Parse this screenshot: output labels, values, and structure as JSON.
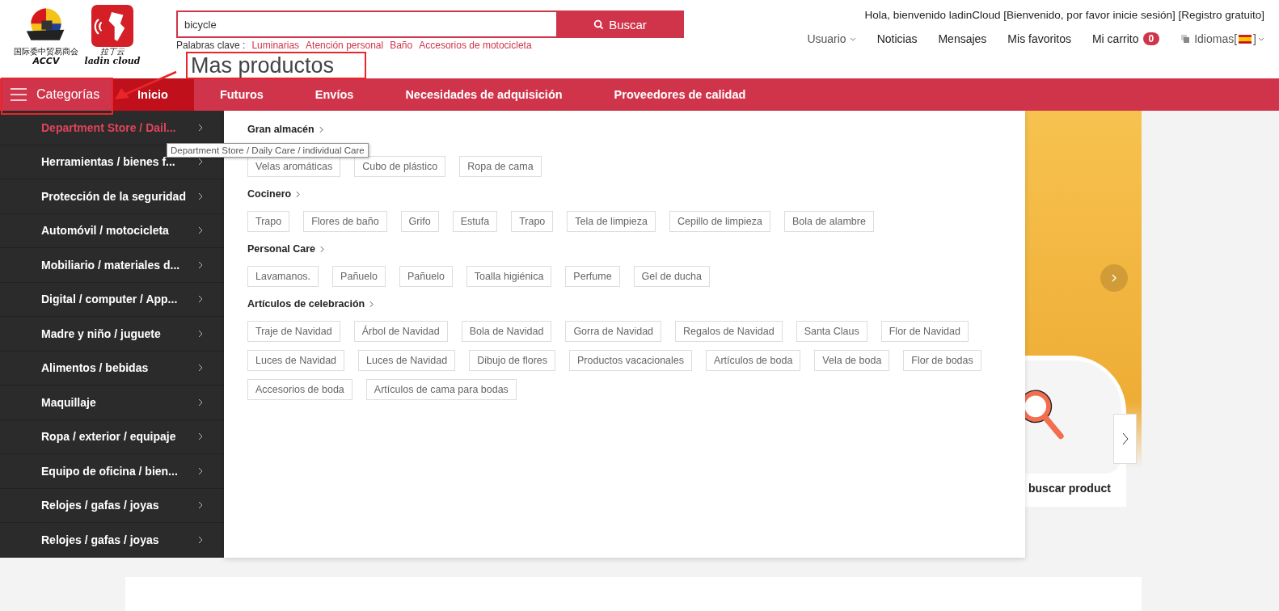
{
  "logos": [
    {
      "kind": "accv",
      "lines": [
        "国际委中贸易商会",
        "ACCV"
      ]
    },
    {
      "kind": "ladin",
      "lines": [
        "拉丁云",
        "ladin cloud"
      ]
    }
  ],
  "search": {
    "value": "bicycle",
    "button": "Buscar",
    "keywords_label": "Palabras clave :",
    "keywords": [
      "Luminarias",
      "Atención personal",
      "Baño",
      "Accesorios de motocicleta"
    ]
  },
  "welcome": "Hola, bienvenido ladinCloud [Bienvenido, por favor inicie sesión] [Registro gratuito]",
  "user_menu": [
    {
      "label": "Usuario",
      "kind": "dropdown"
    },
    {
      "label": "Noticias",
      "kind": "link"
    },
    {
      "label": "Mensajes",
      "kind": "link"
    },
    {
      "label": "Mis favoritos",
      "kind": "link"
    },
    {
      "label": "Mi carrito",
      "kind": "cart",
      "badge": "0"
    },
    {
      "label": "Idiomas[",
      "after": "]",
      "kind": "language"
    }
  ],
  "annotation": {
    "label": "Mas productos"
  },
  "categories_button": "Categorías",
  "nav": [
    {
      "label": "Inicio",
      "selected": true
    },
    {
      "label": "Futuros",
      "selected": false
    },
    {
      "label": "Envíos",
      "selected": false
    },
    {
      "label": "Necesidades de adquisición",
      "selected": false
    },
    {
      "label": "Proveedores de calidad",
      "selected": false
    }
  ],
  "sidebar": {
    "items": [
      {
        "label": "Department Store / Dail...",
        "selected": true
      },
      {
        "label": "Herramientas / bienes f...",
        "selected": false
      },
      {
        "label": "Protección de la seguridad",
        "selected": false
      },
      {
        "label": "Automóvil / motocicleta",
        "selected": false
      },
      {
        "label": "Mobiliario / materiales d...",
        "selected": false
      },
      {
        "label": "Digital / computer / App...",
        "selected": false
      },
      {
        "label": "Madre y niño / juguete",
        "selected": false
      },
      {
        "label": "Alimentos / bebidas",
        "selected": false
      },
      {
        "label": "Maquillaje",
        "selected": false
      },
      {
        "label": "Ropa / exterior / equipaje",
        "selected": false
      },
      {
        "label": "Equipo de oficina / bien...",
        "selected": false
      },
      {
        "label": "Relojes / gafas / joyas",
        "selected": false
      },
      {
        "label": "Relojes / gafas / joyas",
        "selected": false
      }
    ]
  },
  "tooltip": "Department Store / Daily Care / individual Care",
  "dropdown": {
    "sections": [
      {
        "title": "Gran almacén",
        "items": [
          "Velas aromáticas",
          "Cubo de plástico",
          "Ropa de cama"
        ]
      },
      {
        "title": "Cocinero",
        "items": [
          "Trapo",
          "Flores de baño",
          "Grifo",
          "Estufa",
          "Trapo",
          "Tela de limpieza",
          "Cepillo de limpieza",
          "Bola de alambre"
        ]
      },
      {
        "title": "Personal Care",
        "items": [
          "Lavamanos.",
          "Pañuelo",
          "Pañuelo",
          "Toalla higiénica",
          "Perfume",
          "Gel de ducha"
        ]
      },
      {
        "title": "Artículos de celebración",
        "items": [
          "Traje de Navidad",
          "Árbol de Navidad",
          "Bola de Navidad",
          "Gorra de Navidad",
          "Regalos de Navidad",
          "Santa Claus",
          "Flor de Navidad",
          "Luces de Navidad",
          "Luces de Navidad",
          "Dibujo de flores",
          "Productos vacacionales",
          "Artículos de boda",
          "Vela de boda",
          "Flor de bodas",
          "Accesorios de boda",
          "Artículos de cama para bodas"
        ]
      }
    ]
  },
  "promo_card": {
    "label": "buscar product"
  }
}
